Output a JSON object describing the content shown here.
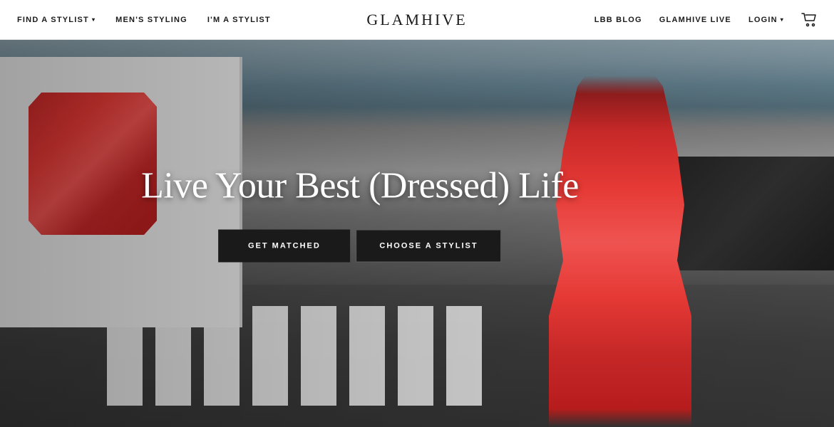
{
  "navbar": {
    "left_items": [
      {
        "label": "FIND A STYLIST",
        "has_arrow": true,
        "id": "find-stylist"
      },
      {
        "label": "MEN'S STYLING",
        "has_arrow": false,
        "id": "mens-styling"
      },
      {
        "label": "I'M A STYLIST",
        "has_arrow": false,
        "id": "im-stylist"
      }
    ],
    "brand": "GLAMHIVE",
    "right_items": [
      {
        "label": "LBB BLOG",
        "id": "lbb-blog"
      },
      {
        "label": "GLAMHIVE LIVE",
        "id": "glamhive-live"
      },
      {
        "label": "LOGIN",
        "has_arrow": true,
        "id": "login"
      }
    ],
    "cart_label": "cart"
  },
  "hero": {
    "headline": "Live Your Best (Dressed) Life",
    "btn_matched": "GET MATCHED",
    "btn_stylist": "CHOOSE A STYLIST"
  }
}
